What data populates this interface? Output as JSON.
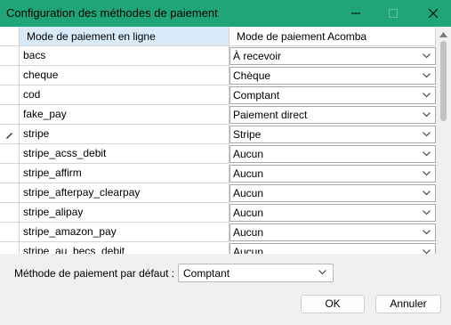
{
  "window": {
    "title": "Configuration des méthodes de paiement",
    "controls": [
      "minimize-icon",
      "maximize-icon",
      "close-icon"
    ]
  },
  "grid": {
    "columns": [
      "Mode de paiement en ligne",
      "Mode de paiement Acomba"
    ],
    "rows": [
      {
        "online": "bacs",
        "acomba": "À recevoir"
      },
      {
        "online": "cheque",
        "acomba": "Chèque"
      },
      {
        "online": "cod",
        "acomba": "Comptant"
      },
      {
        "online": "fake_pay",
        "acomba": "Paiement direct"
      },
      {
        "online": "stripe",
        "acomba": "Stripe"
      },
      {
        "online": "stripe_acss_debit",
        "acomba": "Aucun"
      },
      {
        "online": "stripe_affirm",
        "acomba": "Aucun"
      },
      {
        "online": "stripe_afterpay_clearpay",
        "acomba": "Aucun"
      },
      {
        "online": "stripe_alipay",
        "acomba": "Aucun"
      },
      {
        "online": "stripe_amazon_pay",
        "acomba": "Aucun"
      },
      {
        "online": "stripe_au_becs_debit",
        "acomba": "Aucun"
      }
    ],
    "editing_row_icon": "pencil-icon"
  },
  "footer": {
    "default_label": "Méthode de paiement par défaut :",
    "default_value": "Comptant",
    "ok_label": "OK",
    "cancel_label": "Annuler"
  },
  "colors": {
    "titlebar": "#1fa579",
    "header_selected": "#d9ebf9"
  }
}
